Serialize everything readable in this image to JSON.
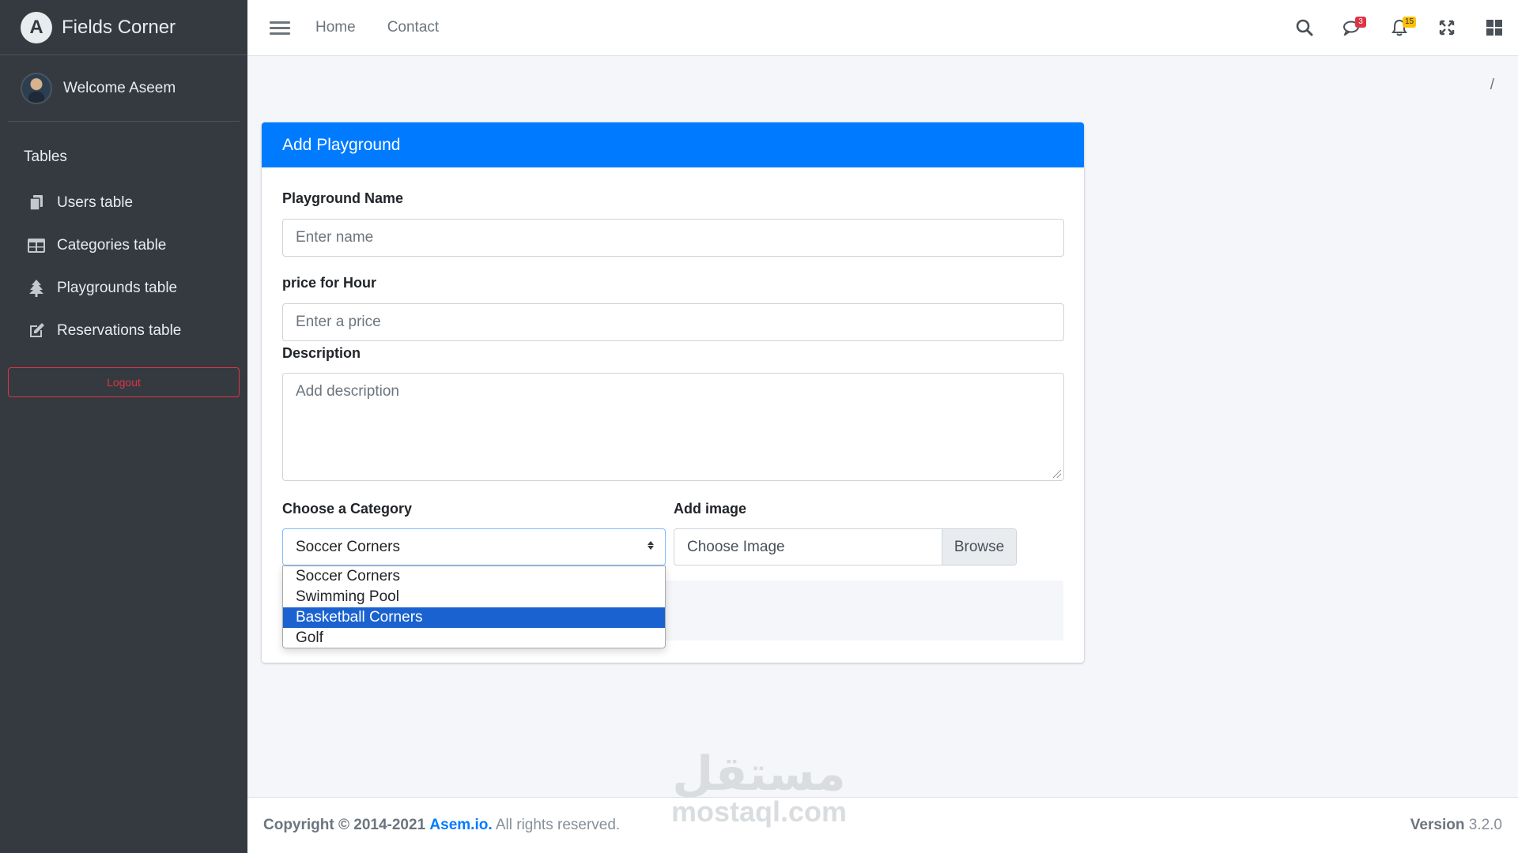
{
  "brand": {
    "logo_letter": "A",
    "name": "Fields Corner"
  },
  "user": {
    "welcome": "Welcome Aseem"
  },
  "sidebar": {
    "header": "Tables",
    "items": [
      {
        "label": "Users table",
        "icon": "copy-icon"
      },
      {
        "label": "Categories table",
        "icon": "table-icon"
      },
      {
        "label": "Playgrounds table",
        "icon": "tree-icon"
      },
      {
        "label": "Reservations table",
        "icon": "edit-icon"
      }
    ],
    "logout": "Logout"
  },
  "topbar": {
    "links": [
      "Home",
      "Contact"
    ],
    "messages_badge": "3",
    "notifications_badge": "15"
  },
  "breadcrumb": {
    "separator": "/"
  },
  "form": {
    "title": "Add Playground",
    "name_label": "Playground Name",
    "name_placeholder": "Enter name",
    "price_label": "price for Hour",
    "price_placeholder": "Enter a price",
    "description_label": "Description",
    "description_placeholder": "Add description",
    "category_label": "Choose a Category",
    "category_selected": "Soccer Corners",
    "category_options": [
      "Soccer Corners",
      "Swimming Pool",
      "Basketball Corners",
      "Golf"
    ],
    "category_highlighted": "Basketball Corners",
    "image_label": "Add image",
    "image_placeholder": "Choose Image",
    "browse": "Browse"
  },
  "footer": {
    "copyright": "Copyright © 2014-2021",
    "company": "Asem.io.",
    "rights": "All rights reserved.",
    "version_label": "Version",
    "version_value": "3.2.0"
  },
  "watermark": {
    "arabic": "مستقل",
    "latin": "mostaql.com"
  },
  "colors": {
    "primary": "#007bff",
    "sidebar": "#343a40",
    "danger": "#dc3545",
    "warning": "#ffc107",
    "selected_option": "#1a62d0"
  }
}
